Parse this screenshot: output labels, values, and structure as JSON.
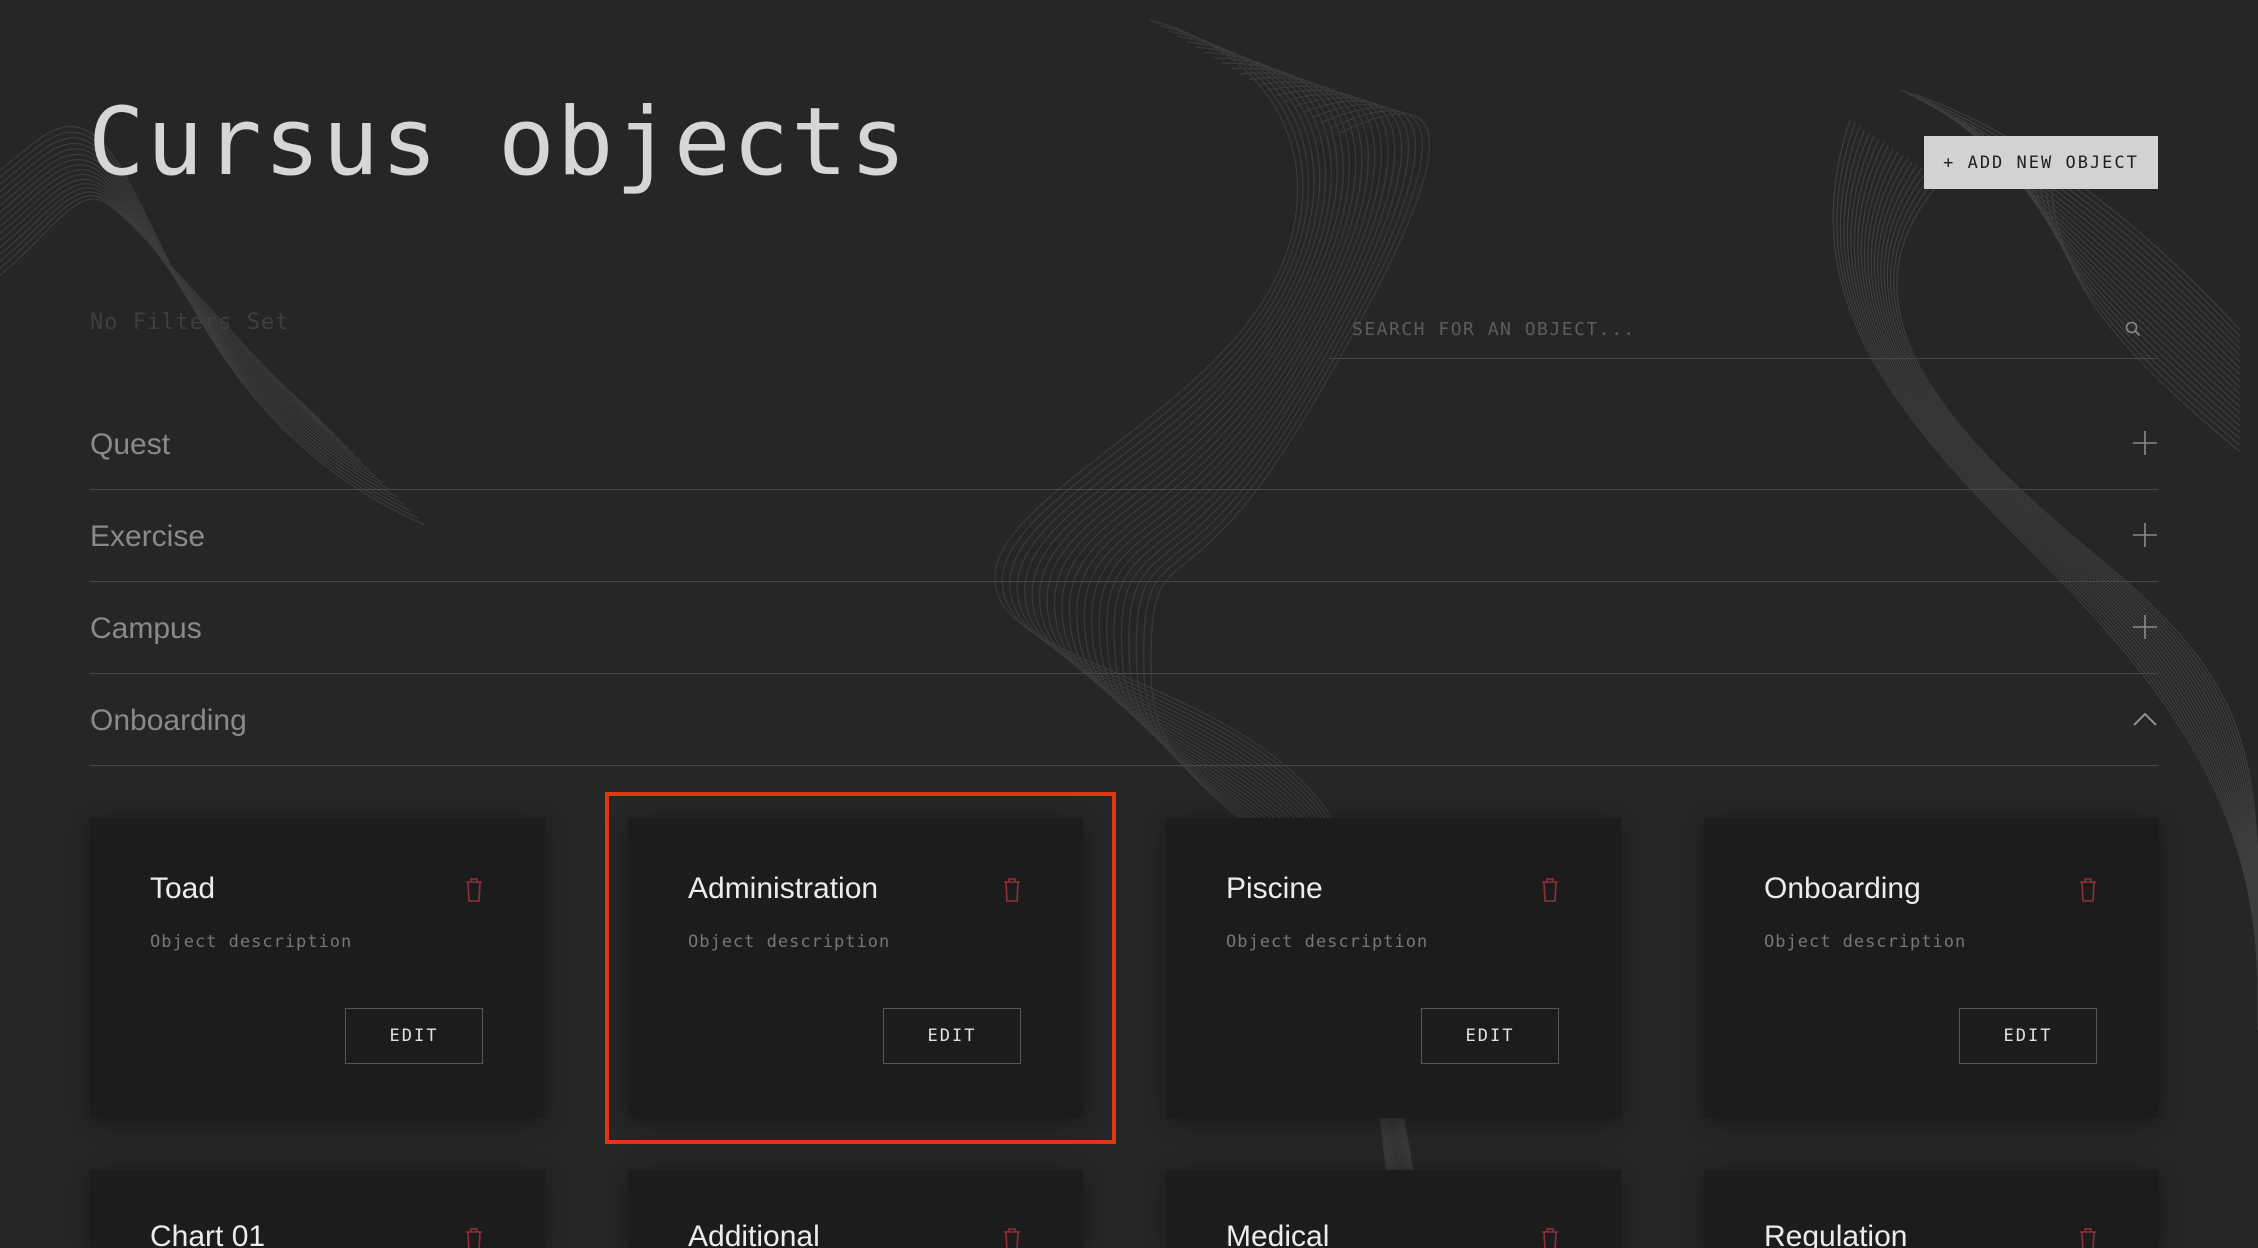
{
  "page": {
    "title": "Cursus objects",
    "add_button": "+ ADD NEW OBJECT",
    "filters_text": "No Filters Set",
    "search_placeholder": "SEARCH FOR AN OBJECT..."
  },
  "categories": [
    {
      "label": "Quest",
      "expanded": false
    },
    {
      "label": "Exercise",
      "expanded": false
    },
    {
      "label": "Campus",
      "expanded": false
    },
    {
      "label": "Onboarding",
      "expanded": true
    }
  ],
  "cards": [
    {
      "title": "Toad",
      "description": "Object description",
      "edit_label": "EDIT"
    },
    {
      "title": "Administration",
      "description": "Object description",
      "edit_label": "EDIT",
      "highlighted": true
    },
    {
      "title": "Piscine",
      "description": "Object description",
      "edit_label": "EDIT"
    },
    {
      "title": "Onboarding",
      "description": "Object description",
      "edit_label": "EDIT"
    },
    {
      "title": "Chart 01"
    },
    {
      "title": "Additional"
    },
    {
      "title": "Medical"
    },
    {
      "title": "Regulation"
    }
  ],
  "colors": {
    "background": "#262626",
    "card": "#1c1c1c",
    "trash": "#8f2f3c",
    "highlight": "#e03614",
    "primary_button": "#d2d2d2"
  },
  "icons": {
    "search": "search-icon",
    "expand": "plus-icon",
    "collapse": "chevron-up-icon",
    "delete": "trash-icon"
  }
}
